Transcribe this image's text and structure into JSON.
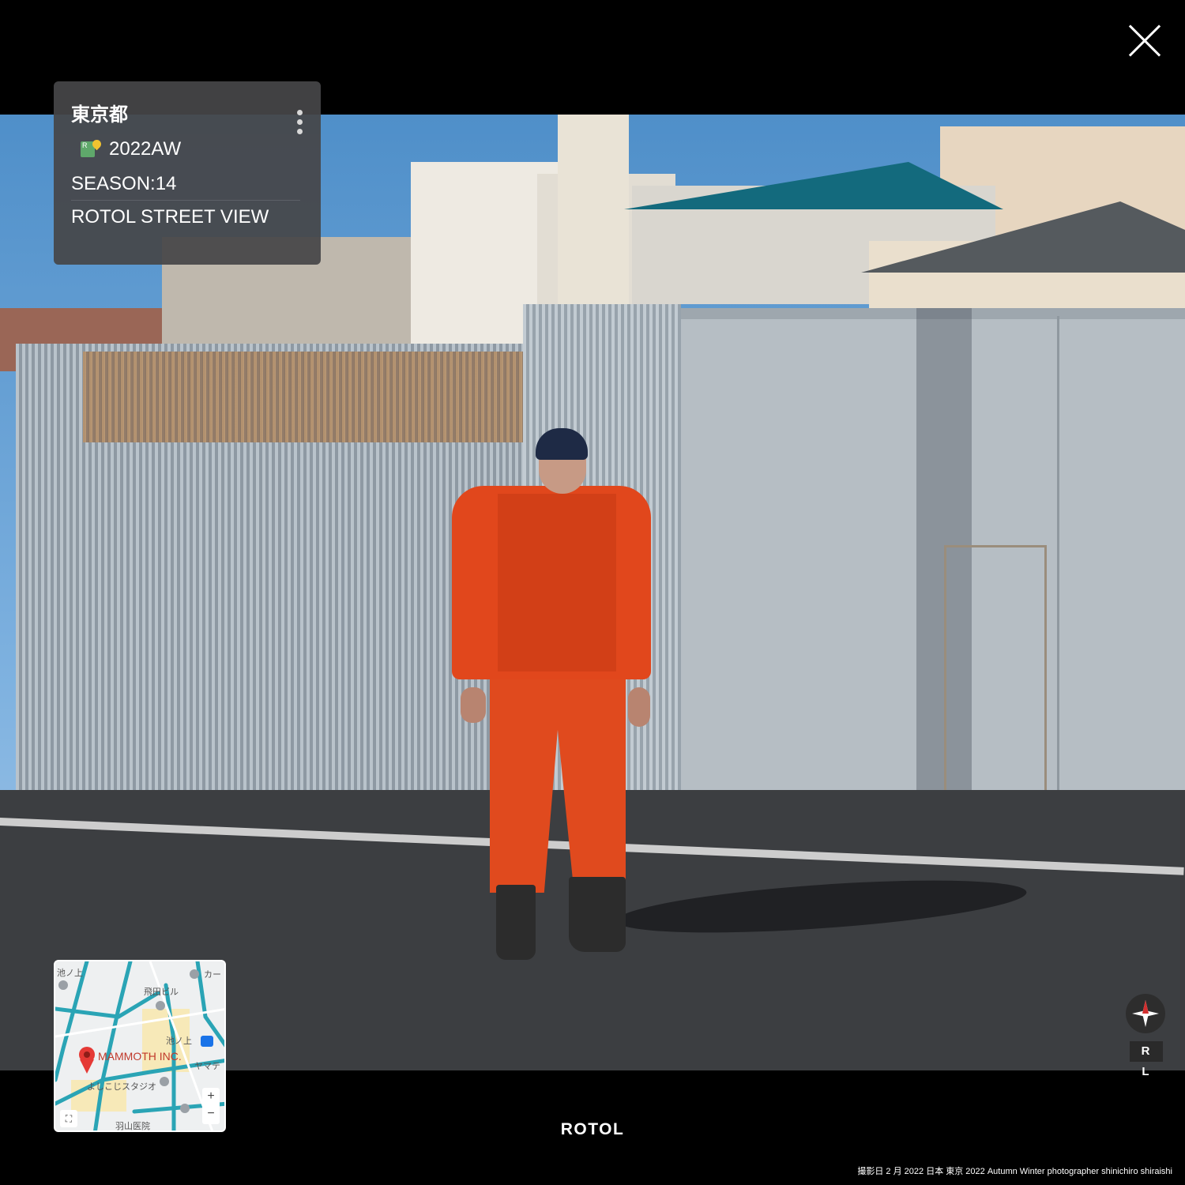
{
  "info_card": {
    "location": "東京都",
    "year_label": "2022AW",
    "icon": "rotol-map-pin-icon",
    "season": "SEASON:14",
    "view_title": "ROTOL STREET VIEW"
  },
  "map": {
    "labels": [
      "池ノ上",
      "カー",
      "飛田ビル",
      "池ノ上",
      "MAMMOTH INC.",
      "ヤマテ",
      "よしこじスタジオ",
      "羽山医院"
    ],
    "zoom_in": "+",
    "zoom_out": "−",
    "fullscreen": "⛶"
  },
  "compass": {
    "letters": "R L",
    "icon": "compass-icon"
  },
  "brand": "ROTOL",
  "caption": "撮影日 2 月 2022 日本 東京 2022 Autumn Winter photographer shinichiro shiraishi",
  "close_icon": "close-icon",
  "colors": {
    "background": "#000000",
    "card": "#464648",
    "accent_orange": "#e1471c"
  }
}
